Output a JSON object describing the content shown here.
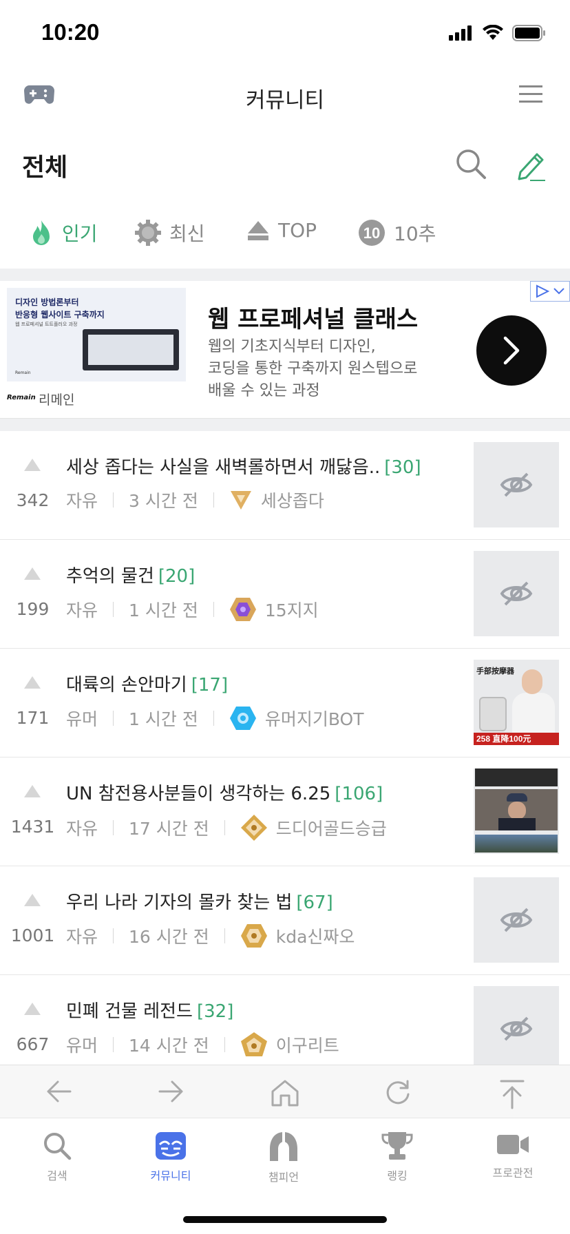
{
  "status_bar": {
    "time": "10:20"
  },
  "header": {
    "title": "커뮤니티"
  },
  "board": {
    "name": "전체"
  },
  "sort_tabs": [
    {
      "label": "인기",
      "icon": "fire-icon",
      "active": true
    },
    {
      "label": "최신",
      "icon": "gear-icon",
      "active": false
    },
    {
      "label": "TOP",
      "icon": "up-triangle-icon",
      "active": false
    },
    {
      "label": "10추",
      "icon": "ten-circle-icon",
      "badge": "10",
      "active": false
    }
  ],
  "ad": {
    "thumb_line1": "디자인 방법론부터",
    "thumb_line2": "반응형 웹사이트 구축까지",
    "thumb_line3": "웹 프로페셔널 트트플러오 과정",
    "thumb_logo": "Remain",
    "brand_logo": "Remain",
    "brand": "리메인",
    "headline": "웹 프로페셔널 클래스",
    "description_lines": [
      "웹의 기초지식부터 디자인,",
      "코딩을 통한 구축까지 원스텝으로",
      "배울 수 있는 과정"
    ]
  },
  "posts": [
    {
      "votes": "342",
      "title": "세상 좁다는 사실을 새벽롤하면서 깨닳음..",
      "comments": "[30]",
      "category": "자유",
      "time": "3 시간 전",
      "author": "세상좁다",
      "badge_color": "#d4a24a",
      "thumbnail": "hidden"
    },
    {
      "votes": "199",
      "title": "추억의 물건",
      "comments": "[20]",
      "category": "자유",
      "time": "1 시간 전",
      "author": "15지지",
      "badge_color": "#8a4fd6",
      "thumbnail": "hidden"
    },
    {
      "votes": "171",
      "title": "대륙의 손안마기",
      "comments": "[17]",
      "category": "유머",
      "time": "1 시간 전",
      "author": "유머지기BOT",
      "badge_color": "#2ab4f0",
      "thumbnail": "product",
      "thumb_text": "手部按摩器",
      "thumb_price": "258 直降100元"
    },
    {
      "votes": "1431",
      "title": "UN 참전용사분들이 생각하는 6.25",
      "comments": "[106]",
      "category": "자유",
      "time": "17 시간 전",
      "author": "드디어골드승급",
      "badge_color": "#d9a84a",
      "thumbnail": "video"
    },
    {
      "votes": "1001",
      "title": "우리 나라 기자의 몰카 찾는 법",
      "comments": "[67]",
      "category": "자유",
      "time": "16 시간 전",
      "author": "kda신짜오",
      "badge_color": "#d9a84a",
      "thumbnail": "hidden"
    },
    {
      "votes": "667",
      "title": "민폐 건물 레전드",
      "comments": "[32]",
      "category": "유머",
      "time": "14 시간 전",
      "author": "이구리트",
      "badge_color": "#d9a84a",
      "thumbnail": "hidden"
    }
  ],
  "bottom_tabs": [
    {
      "label": "검색",
      "icon": "search-icon",
      "active": false
    },
    {
      "label": "커뮤니티",
      "icon": "community-icon",
      "active": true
    },
    {
      "label": "챔피언",
      "icon": "helmet-icon",
      "active": false
    },
    {
      "label": "랭킹",
      "icon": "trophy-icon",
      "active": false
    },
    {
      "label": "프로관전",
      "icon": "video-camera-icon",
      "active": false
    }
  ],
  "colors": {
    "accent_green": "#3aa672",
    "accent_blue": "#4a72e8",
    "muted": "#999999"
  }
}
